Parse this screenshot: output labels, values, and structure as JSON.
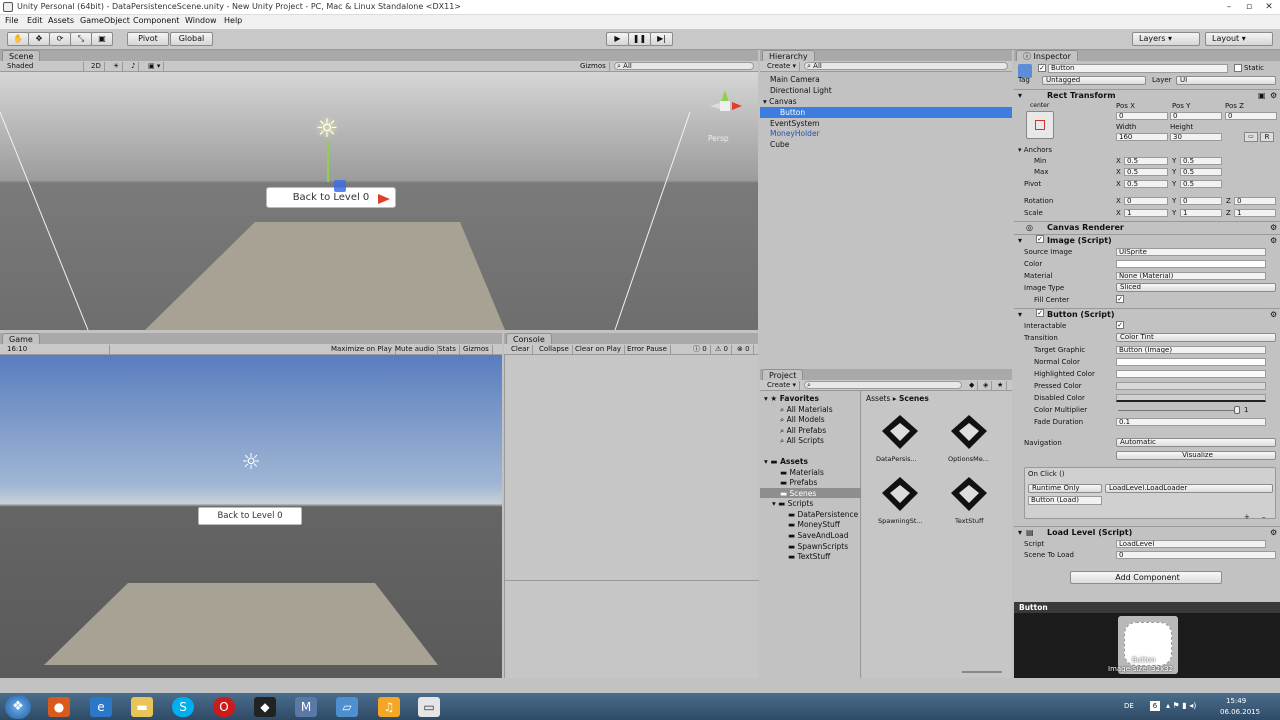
{
  "window": {
    "title": "Unity Personal (64bit) - DataPersistenceScene.unity - New Unity Project - PC, Mac & Linux Standalone <DX11>"
  },
  "menu": [
    "File",
    "Edit",
    "Assets",
    "GameObject",
    "Component",
    "Window",
    "Help"
  ],
  "toolbar": {
    "pivot": "Pivot",
    "global": "Global",
    "layers": "Layers",
    "layout": "Layout"
  },
  "scene": {
    "tab": "Scene",
    "shading": "Shaded",
    "mode2d": "2D",
    "gizmos": "Gizmos",
    "search_placeholder": "All",
    "persp": "Persp",
    "button_text": "Back to Level 0"
  },
  "game": {
    "tab": "Game",
    "aspect": "16:10",
    "options": [
      "Maximize on Play",
      "Mute audio",
      "Stats",
      "Gizmos"
    ],
    "button_text": "Back to Level 0"
  },
  "console": {
    "tab": "Console",
    "options": [
      "Clear",
      "Collapse",
      "Clear on Play",
      "Error Pause"
    ],
    "counts": [
      "0",
      "0",
      "0"
    ]
  },
  "hierarchy": {
    "tab": "Hierarchy",
    "create": "Create",
    "search_placeholder": "All",
    "items": [
      "Main Camera",
      "Directional Light",
      "Canvas",
      "Button",
      "EventSystem",
      "MoneyHolder",
      "Cube"
    ]
  },
  "project": {
    "tab": "Project",
    "create": "Create",
    "favorites_label": "Favorites",
    "favorites": [
      "All Materials",
      "All Models",
      "All Prefabs",
      "All Scripts"
    ],
    "assets_label": "Assets",
    "folders": [
      "Materials",
      "Prefabs",
      "Scenes",
      "Scripts"
    ],
    "script_folders": [
      "DataPersistence",
      "MoneyStuff",
      "SaveAndLoad",
      "SpawnScripts",
      "TextStuff"
    ],
    "breadcrumb": [
      "Assets",
      "Scenes"
    ],
    "files": [
      "DataPersis...",
      "OptionsMe...",
      "SpawningSt...",
      "TextStuff"
    ]
  },
  "inspector": {
    "tab": "Inspector",
    "name": "Button",
    "static": "Static",
    "tag_label": "Tag",
    "tag": "Untagged",
    "layer_label": "Layer",
    "layer": "UI",
    "rect": {
      "title": "Rect Transform",
      "anchor_preset_top": "center",
      "anchor_preset_side": "middle",
      "posx_label": "Pos X",
      "posy_label": "Pos Y",
      "posz_label": "Pos Z",
      "posx": "0",
      "posy": "0",
      "posz": "0",
      "width_label": "Width",
      "height_label": "Height",
      "width": "160",
      "height": "30",
      "anchors": "Anchors",
      "min": "Min",
      "max": "Max",
      "pivot": "Pivot",
      "min_x": "0.5",
      "min_y": "0.5",
      "max_x": "0.5",
      "max_y": "0.5",
      "pivot_x": "0.5",
      "pivot_y": "0.5",
      "rotation": "Rotation",
      "rot_x": "0",
      "rot_y": "0",
      "rot_z": "0",
      "scale": "Scale",
      "scale_x": "1",
      "scale_y": "1",
      "scale_z": "1",
      "x": "X",
      "y": "Y",
      "z": "Z",
      "r": "R"
    },
    "canvas_renderer": "Canvas Renderer",
    "image": {
      "title": "Image (Script)",
      "source_image_label": "Source Image",
      "source_image": "UISprite",
      "color_label": "Color",
      "material_label": "Material",
      "material": "None (Material)",
      "image_type_label": "Image Type",
      "image_type": "Sliced",
      "fill_center_label": "Fill Center"
    },
    "button": {
      "title": "Button (Script)",
      "interactable_label": "Interactable",
      "transition_label": "Transition",
      "transition": "Color Tint",
      "target_graphic_label": "Target Graphic",
      "target_graphic": "Button (Image)",
      "normal_color": "Normal Color",
      "highlighted_color": "Highlighted Color",
      "pressed_color": "Pressed Color",
      "disabled_color": "Disabled Color",
      "color_multiplier_label": "Color Multiplier",
      "color_multiplier": "1",
      "color_multiplier_value": 1,
      "fade_duration_label": "Fade Duration",
      "fade_duration": "0.1",
      "navigation_label": "Navigation",
      "navigation": "Automatic",
      "visualize": "Visualize",
      "onclick": "On Click ()",
      "runtime": "Runtime Only",
      "function": "LoadLevel.LoadLoader",
      "object": "Button (Load)"
    },
    "loadlevel": {
      "title": "Load Level (Script)",
      "script_label": "Script",
      "script": "LoadLevel",
      "scene_label": "Scene To Load",
      "scene": "0"
    },
    "add_component": "Add Component",
    "preview_title": "Button",
    "preview_caption": "Button",
    "preview_size": "Image Size: 32x32"
  },
  "taskbar": {
    "lang": "DE",
    "time": "15:49",
    "date": "06.06.2015",
    "badge": "6"
  }
}
